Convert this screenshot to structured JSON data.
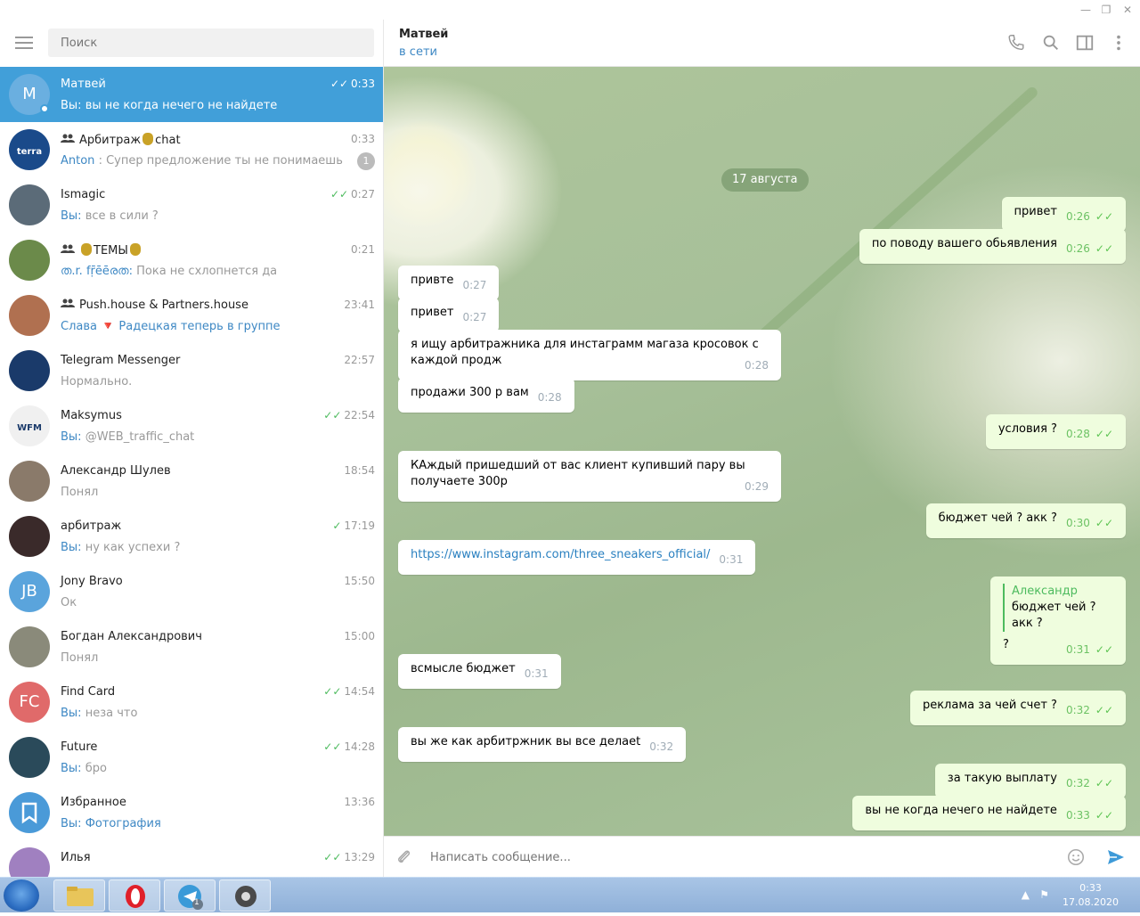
{
  "search": {
    "placeholder": "Поиск"
  },
  "chats": [
    {
      "name": "Матвей",
      "who": "Вы:",
      "text": "вы не когда нечего не найдете",
      "time": "0:33",
      "read": true,
      "avatar_letter": "М",
      "avatar_color": "#6aafe0",
      "active": true
    },
    {
      "name": "Арбитраж",
      "name_suffix": "chat",
      "group": true,
      "who": "Anton",
      "text": ": Супер предложение ты не понимаешь",
      "time": "0:33",
      "badge": "1",
      "avatar_color": "#1a4a8a",
      "avatar_text": "terra leads"
    },
    {
      "name": "Ismagic",
      "who": "Вы:",
      "text": "все в сили ?",
      "time": "0:27",
      "read": true,
      "avatar_color": "#5b6b78"
    },
    {
      "name": "ТЕМЫ",
      "group": true,
      "who": "ത.r. fṝēēരത:",
      "text": "Пока не схлопнется да",
      "time": "0:21",
      "avatar_color": "#6b8a4a"
    },
    {
      "name": "Push.house & Partners.house",
      "group": true,
      "who": "Слава 🔻 Радецкая теперь в группе",
      "text": "",
      "time": "23:41",
      "avatar_color": "#b07050"
    },
    {
      "name": "Telegram Messenger",
      "who": "",
      "text": "Нормально.",
      "time": "22:57",
      "avatar_color": "#1a3a6a"
    },
    {
      "name": "Maksymus",
      "who": "Вы:",
      "text": "@WEB_traffic_chat",
      "time": "22:54",
      "read": true,
      "avatar_color": "#f0f0f0",
      "avatar_text": "WFM"
    },
    {
      "name": "Александр Шулев",
      "who": "",
      "text": "Понял",
      "time": "18:54",
      "avatar_color": "#8a7a6a"
    },
    {
      "name": "арбитраж",
      "who": "Вы:",
      "text": "ну как успехи ?",
      "time": "17:19",
      "read": true,
      "single": true,
      "avatar_color": "#3a2a2a"
    },
    {
      "name": "Jony Bravo",
      "who": "",
      "text": "Ок",
      "time": "15:50",
      "avatar_letter": "JB",
      "avatar_color": "#5aa4dc"
    },
    {
      "name": "Богдан Александрович",
      "who": "",
      "text": "Понял",
      "time": "15:00",
      "avatar_color": "#8a8a7a"
    },
    {
      "name": "Find Card",
      "who": "Вы:",
      "text": "неза что",
      "time": "14:54",
      "read": true,
      "avatar_letter": "FC",
      "avatar_color": "#e06a6a"
    },
    {
      "name": "Future",
      "who": "Вы:",
      "text": "бро",
      "time": "14:28",
      "read": true,
      "avatar_color": "#2a4a5a"
    },
    {
      "name": "Избранное",
      "who": "Вы:",
      "text": "Фотография",
      "time": "13:36",
      "avatar_color": "#4a9ad8",
      "bookmark": true
    },
    {
      "name": "Илья",
      "who": "",
      "text": "",
      "time": "13:29",
      "read": true,
      "avatar_color": "#a080c0"
    }
  ],
  "header": {
    "title": "Матвей",
    "status": "в сети"
  },
  "date_pill": "17 августа",
  "messages": [
    {
      "dir": "out",
      "text": "привет",
      "time": "0:26"
    },
    {
      "dir": "out",
      "text": "по поводу вашего обьявления",
      "time": "0:26"
    },
    {
      "dir": "in",
      "text": "привте",
      "time": "0:27"
    },
    {
      "dir": "in",
      "text": "привет",
      "time": "0:27"
    },
    {
      "dir": "in",
      "text": "я ищу арбитражника для инстаграмм магаза кросовок с каждой продж",
      "time": "0:28"
    },
    {
      "dir": "in",
      "text": "продажи 300 р вам",
      "time": "0:28"
    },
    {
      "dir": "out",
      "text": "условия ?",
      "time": "0:28"
    },
    {
      "dir": "in",
      "text": "КАждый пришедший от вас клиент купивший пару вы получаете 300р",
      "time": "0:29"
    },
    {
      "dir": "out",
      "text": "бюджет чей ? акк ?",
      "time": "0:30"
    },
    {
      "dir": "in",
      "text": "https://www.instagram.com/three_sneakers_official/",
      "time": "0:31",
      "link": true
    },
    {
      "dir": "out",
      "reply_name": "Александр",
      "reply_text": "бюджет чей ? акк ?",
      "text": "?",
      "time": "0:31"
    },
    {
      "dir": "in",
      "text": "всмысле бюджет",
      "time": "0:31"
    },
    {
      "dir": "out",
      "text": "реклама за чей счет ?",
      "time": "0:32"
    },
    {
      "dir": "in",
      "text": "вы же как арбитржник вы все делаеt",
      "time": "0:32"
    },
    {
      "dir": "out",
      "text": "за такую выплату",
      "time": "0:32"
    },
    {
      "dir": "out",
      "text": "вы не когда нечего не найдете",
      "time": "0:33"
    }
  ],
  "composer": {
    "placeholder": "Написать сообщение..."
  },
  "taskbar": {
    "time": "0:33",
    "date": "17.08.2020",
    "telegram_badge": "1"
  }
}
